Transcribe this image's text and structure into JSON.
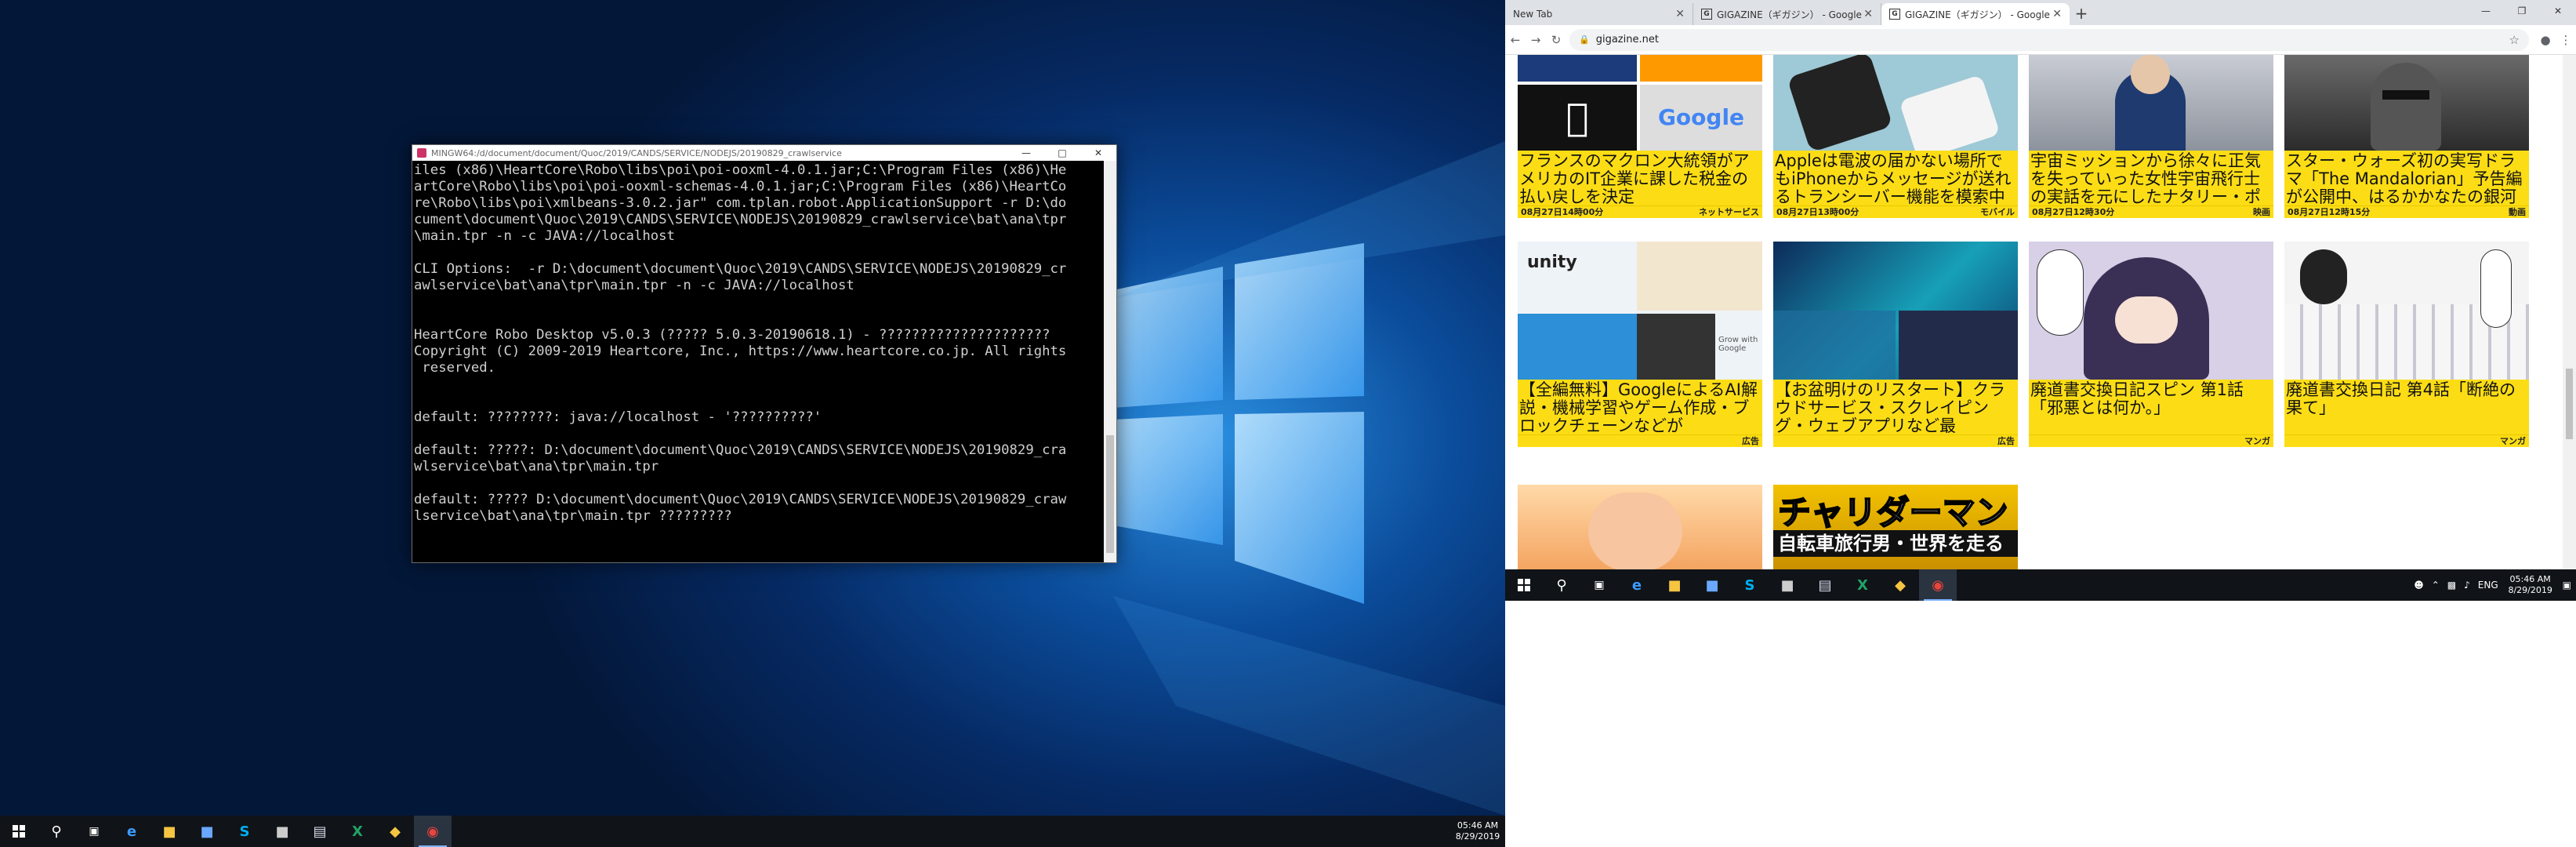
{
  "terminal": {
    "title": "MINGW64:/d/document/document/Quoc/2019/CANDS/SERVICE/NODEJS/20190829_crawlservice",
    "lines": [
      "iles (x86)\\HeartCore\\Robo\\libs\\poi\\poi-ooxml-4.0.1.jar;C:\\Program Files (x86)\\He",
      "artCore\\Robo\\libs\\poi\\poi-ooxml-schemas-4.0.1.jar;C:\\Program Files (x86)\\HeartCo",
      "re\\Robo\\libs\\poi\\xmlbeans-3.0.2.jar\" com.tplan.robot.ApplicationSupport -r D:\\do",
      "cument\\document\\Quoc\\2019\\CANDS\\SERVICE\\NODEJS\\20190829_crawlservice\\bat\\ana\\tpr",
      "\\main.tpr -n -c JAVA://localhost",
      "",
      "CLI Options:  -r D:\\document\\document\\Quoc\\2019\\CANDS\\SERVICE\\NODEJS\\20190829_cr",
      "awlservice\\bat\\ana\\tpr\\main.tpr -n -c JAVA://localhost",
      "",
      "",
      "HeartCore Robo Desktop v5.0.3 (????? 5.0.3-20190618.1) - ?????????????????????",
      "Copyright (C) 2009-2019 Heartcore, Inc., https://www.heartcore.co.jp. All rights",
      " reserved.",
      "",
      "",
      "default: ????????: java://localhost - '??????????'",
      "",
      "default: ?????: D:\\document\\document\\Quoc\\2019\\CANDS\\SERVICE\\NODEJS\\20190829_cra",
      "wlservice\\bat\\ana\\tpr\\main.tpr",
      "",
      "default: ????? D:\\document\\document\\Quoc\\2019\\CANDS\\SERVICE\\NODEJS\\20190829_craw",
      "lservice\\bat\\ana\\tpr\\main.tpr ?????????"
    ]
  },
  "taskbar_left": {
    "icons": [
      "windows-icon",
      "search-icon",
      "task-view-icon",
      "edge-icon",
      "file-explorer-icon",
      "app-icon",
      "skype-icon",
      "app-icon-2",
      "notepad-icon",
      "excel-icon",
      "git-icon",
      "chrome-icon"
    ],
    "time": "05:46 AM",
    "date": "8/29/2019"
  },
  "browser": {
    "tabs": [
      {
        "label": "New Tab",
        "active": false
      },
      {
        "label": "GIGAZINE（ギガジン） - Google ...",
        "active": false
      },
      {
        "label": "GIGAZINE（ギガジン） - Google ...",
        "active": true
      }
    ],
    "favicon_letter": "G",
    "url": "gigazine.net"
  },
  "articles": [
    {
      "caption": "フランスのマクロン大統領がアメリカのIT企業に課した税金の払い戻しを決定",
      "date": "08月27日14時00分",
      "category": "ネットサービス"
    },
    {
      "caption": "Appleは電波の届かない場所でもiPhoneからメッセージが送れるトランシーバー機能を模索中",
      "date": "08月27日13時00分",
      "category": "モバイル"
    },
    {
      "caption": "宇宙ミッションから徐々に正気を失っていった女性宇宙飛行士の実話を元にしたナタリー・ポートマン主演",
      "date": "08月27日12時30分",
      "category": "映画"
    },
    {
      "caption": "スター・ウォーズ初の実写ドラマ「The Mandalorian」予告編が公開中、はるかかなたの銀河系を旅する",
      "date": "08月27日12時15分",
      "category": "動画"
    },
    {
      "caption": "【全編無料】GoogleによるAI解説・機械学習やゲーム作成・ブロックチェーンなどが",
      "date": "",
      "category": "広告"
    },
    {
      "caption": "【お盆明けのリスタート】クラウドサービス・スクレイピング・ウェブアプリなど最",
      "date": "",
      "category": "広告"
    },
    {
      "caption": "廃道書交換日記スピン 第1話「邪悪とは何か。」",
      "date": "",
      "category": "マンガ"
    },
    {
      "caption": "廃道書交換日記 第4話「断絶の果て」",
      "date": "",
      "category": "マンガ"
    }
  ],
  "thumb_text": {
    "unity": "unity",
    "google": "Google",
    "grow": "Grow with Google",
    "banner": "チャリダーマン",
    "banner_sub": "自転車旅行男・世界を走る"
  },
  "taskbar_right": {
    "time": "05:46 AM",
    "date": "8/29/2019",
    "lang": "ENG"
  },
  "colors": {
    "caption_bg": "#fcdd15",
    "desktop_blue": "#0b4d9c",
    "taskbar": "#101418"
  }
}
